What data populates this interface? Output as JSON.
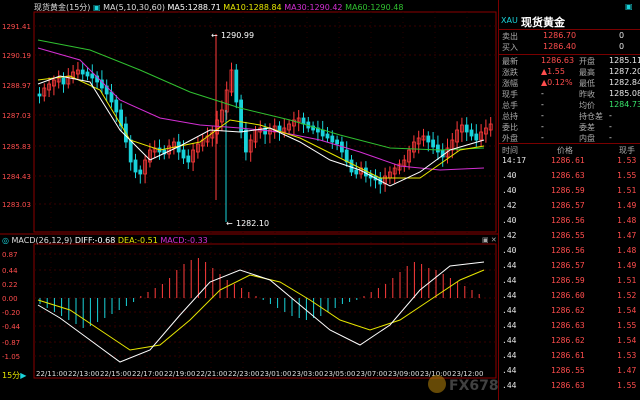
{
  "header": {
    "symbol_label": "现货黄金(15分)",
    "ma_label": "MA(5,10,30,60)",
    "ma5": "MA5:1288.71",
    "ma10": "MA10:1288.84",
    "ma30": "MA30:1290.42",
    "ma60": "MA60:1290.48"
  },
  "macd_header": {
    "label": "MACD(26,12,9)",
    "diff": "DIFF:-0.68",
    "dea": "DEA:-0.51",
    "macd": "MACD:-0.33"
  },
  "price_axis": [
    "1291.41",
    "1290.19",
    "1288.97",
    "1287.03",
    "1285.83",
    "1284.43",
    "1283.03"
  ],
  "macd_axis": [
    "0.87",
    "0.44",
    "0.22",
    "0.00",
    "-0.20",
    "-0.44",
    "-0.87",
    "-1.05"
  ],
  "time_axis": [
    "22/11:00",
    "22/13:00",
    "22/15:00",
    "22/17:00",
    "22/19:00",
    "22/21:00",
    "22/23:00",
    "23/01:00",
    "23/03:00",
    "23/05:00",
    "23/07:00",
    "23/09:00",
    "23/10:00",
    "23/12:00"
  ],
  "annotations": {
    "high": "1290.99",
    "low": "1282.10"
  },
  "period_label": "15分",
  "colors": {
    "up": "#ff3b3b",
    "down": "#19d3da",
    "ma5": "#ffffff",
    "ma10": "#e6e600",
    "ma30": "#d32fd3",
    "ma60": "#30c030",
    "accent": "#8b0000"
  },
  "panel": {
    "title": "现货黄金",
    "code": "XAU",
    "ask_label": "卖出",
    "ask_val": "1286.70",
    "ask_vol": "0",
    "bid_label": "买入",
    "bid_val": "1286.40",
    "bid_vol": "0",
    "rows": [
      {
        "l1": "最新",
        "v1": "1286.63",
        "l2": "开盘",
        "v2": "1285.11"
      },
      {
        "l1": "涨跌",
        "v1": "▲1.55",
        "l2": "最高",
        "v2": "1287.20"
      },
      {
        "l1": "涨幅",
        "v1": "▲0.12%",
        "l2": "最低",
        "v2": "1282.84"
      },
      {
        "l1": "现手",
        "v1": "-",
        "l2": "昨收",
        "v2": "1285.08"
      },
      {
        "l1": "总手",
        "v1": "-",
        "l2": "均价",
        "v2": "1284.73"
      },
      {
        "l1": "总持",
        "v1": "-",
        "l2": "持仓差",
        "v2": "-"
      },
      {
        "l1": "委比",
        "v1": "-",
        "l2": "委差",
        "v2": "-"
      },
      {
        "l1": "外盘",
        "v1": "-",
        "l2": "内盘",
        "v2": "-"
      }
    ],
    "tick_headers": {
      "time": "时间",
      "price": "价格",
      "vol": "现手"
    },
    "ticks": [
      {
        "t": "14:17",
        "p": "1286.61",
        "v": "1.53"
      },
      {
        "t": ".40",
        "p": "1286.63",
        "v": "1.55"
      },
      {
        "t": ".40",
        "p": "1286.59",
        "v": "1.51"
      },
      {
        "t": ".42",
        "p": "1286.57",
        "v": "1.49"
      },
      {
        "t": ".40",
        "p": "1286.56",
        "v": "1.48"
      },
      {
        "t": ".42",
        "p": "1286.55",
        "v": "1.47"
      },
      {
        "t": ".40",
        "p": "1286.56",
        "v": "1.48"
      },
      {
        "t": ".44",
        "p": "1286.57",
        "v": "1.49"
      },
      {
        "t": ".44",
        "p": "1286.59",
        "v": "1.51"
      },
      {
        "t": ".44",
        "p": "1286.60",
        "v": "1.52"
      },
      {
        "t": ".44",
        "p": "1286.62",
        "v": "1.54"
      },
      {
        "t": ".44",
        "p": "1286.63",
        "v": "1.55"
      },
      {
        "t": ".44",
        "p": "1286.62",
        "v": "1.54"
      },
      {
        "t": ".44",
        "p": "1286.61",
        "v": "1.53"
      },
      {
        "t": ".44",
        "p": "1286.55",
        "v": "1.47"
      },
      {
        "t": ".44",
        "p": "1286.63",
        "v": "1.55"
      }
    ]
  },
  "watermark": "FX678 汇通网"
}
